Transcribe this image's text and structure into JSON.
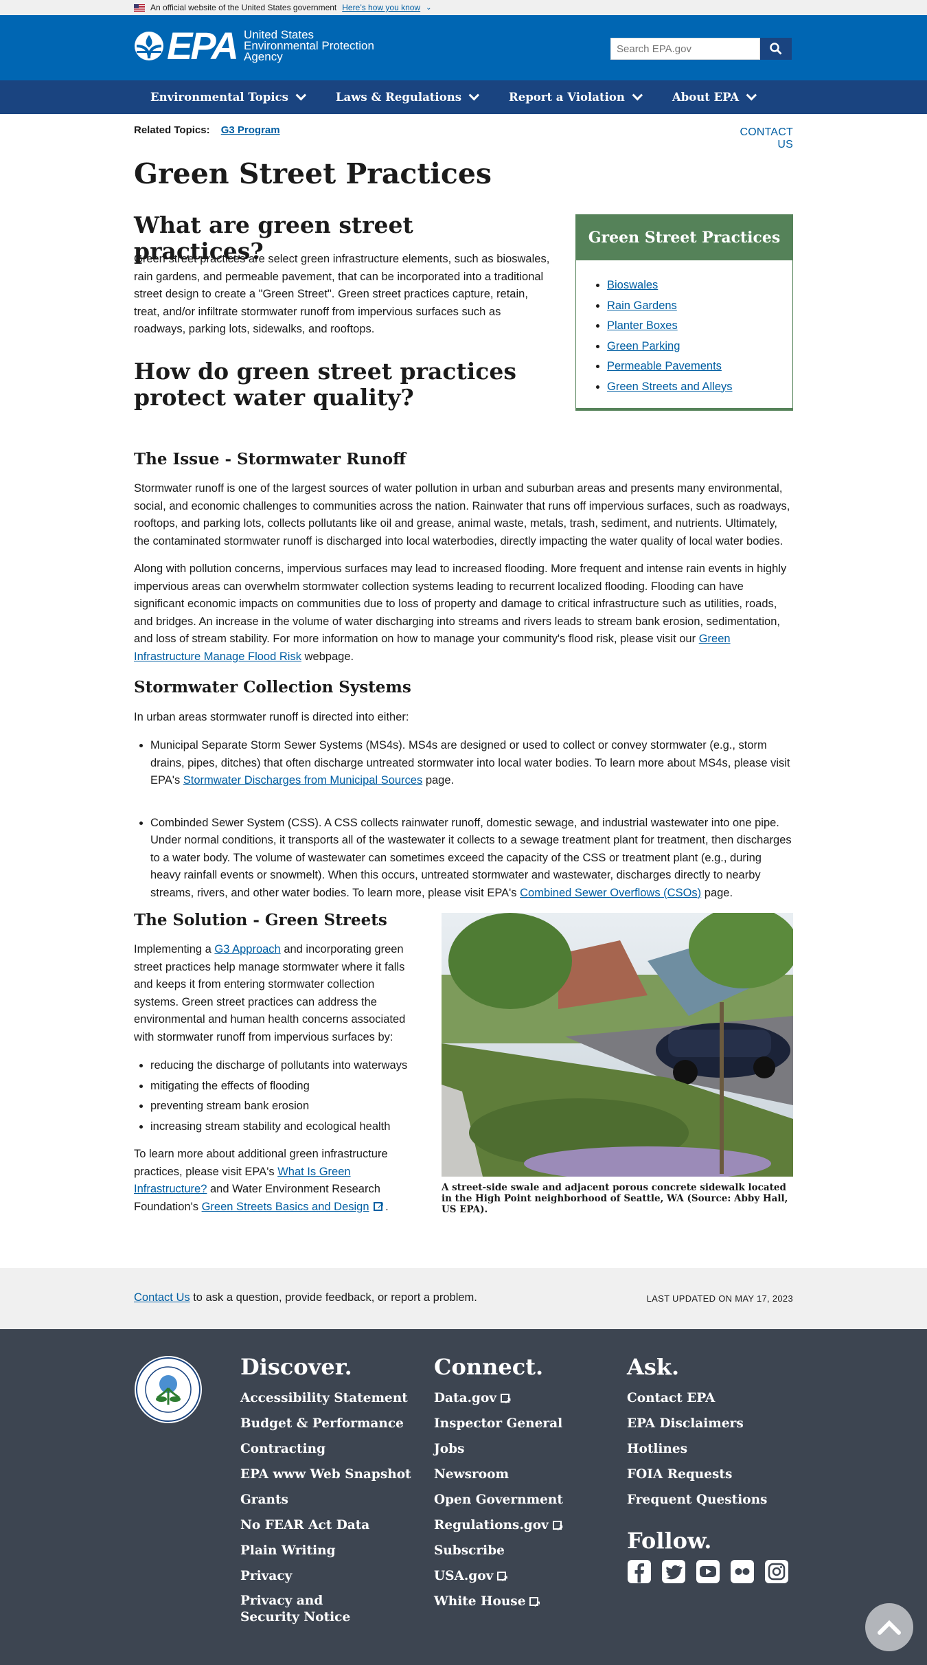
{
  "gov_banner": {
    "text": "An official website of the United States government",
    "link": "Here’s how you know"
  },
  "header": {
    "logo_text": "EPA",
    "agency_line1": "United States",
    "agency_line2": "Environmental Protection",
    "agency_line3": "Agency",
    "search_placeholder": "Search EPA.gov"
  },
  "nav": [
    "Environmental Topics",
    "Laws & Regulations",
    "Report a Violation",
    "About EPA"
  ],
  "related": {
    "label": "Related Topics:",
    "link": "G3 Program",
    "contact": "CONTACT US"
  },
  "page_title": "Green Street Practices",
  "what": {
    "heading": "What are green street practices?",
    "body": "Green street practices are select green infrastructure elements, such as bioswales, rain gardens, and permeable pavement, that can be incorporated into a traditional street design to create a \"Green Street\". Green street practices capture, retain, treat, and/or infiltrate stormwater runoff from impervious surfaces such as roadways, parking lots, sidewalks, and rooftops."
  },
  "how": {
    "heading": "How do green street practices protect water quality?"
  },
  "sidebar": {
    "title": "Green Street Practices",
    "links": [
      "Bioswales",
      "Rain Gardens",
      "Planter Boxes",
      "Green Parking",
      "Permeable Pavements",
      "Green Streets and Alleys"
    ]
  },
  "issue": {
    "heading": "The Issue - Stormwater Runoff",
    "p1": "Stormwater runoff is one of the largest sources of water pollution in urban and suburban areas and presents many environmental, social, and economic challenges to communities across the nation. Rainwater that runs off impervious surfaces, such as roadways, rooftops, and parking lots, collects pollutants like oil and grease, animal waste, metals, trash, sediment, and nutrients.  Ultimately, the contaminated stormwater runoff is discharged into local waterbodies, directly impacting the water quality of local water bodies.",
    "p2_before": "Along with pollution concerns, impervious surfaces may lead to increased flooding.  More frequent and intense rain events in highly impervious areas can overwhelm stormwater collection systems leading to recurrent localized flooding.  Flooding can have significant economic impacts on communities due to loss of property and damage to critical infrastructure such as utilities, roads, and bridges.  An increase in the volume of water discharging into streams and rivers leads to stream bank erosion, sedimentation, and loss of stream stability.  For more information on how to manage your community's flood risk, please visit our ",
    "p2_link": "Green Infrastructure Manage Flood Risk",
    "p2_after": " webpage."
  },
  "collection": {
    "heading": "Stormwater Collection Systems",
    "intro": "In urban areas stormwater runoff is directed into either:",
    "ms4_before": "Municipal Separate Storm Sewer Systems (MS4s).  MS4s are designed or used to collect or convey stormwater (e.g., storm drains, pipes, ditches) that often discharge untreated stormwater into local water bodies.  To learn more about MS4s, please visit EPA's ",
    "ms4_link": "Stormwater Discharges from Municipal Sources",
    "ms4_after": " page.",
    "css_before": "Combinded Sewer System (CSS).  A CSS collects rainwater runoff, domestic sewage, and industrial wastewater into one pipe.  Under normal conditions, it transports all of the wastewater it collects to a sewage treatment plant for treatment, then discharges to a water body. The volume of wastewater can sometimes exceed the capacity of the CSS or treatment plant (e.g., during heavy rainfall events or snowmelt). When this occurs, untreated stormwater and wastewater, discharges directly to nearby streams, rivers, and other water bodies.  To learn more, please visit EPA's ",
    "css_link": "Combined Sewer Overflows (CSOs)",
    "css_after": " page."
  },
  "solution": {
    "heading": "The Solution - Green Streets",
    "p1_before": "Implementing a ",
    "p1_link": "G3 Approach",
    "p1_after": " and incorporating green street practices help manage stormwater where it falls and keeps it from entering stormwater collection systems. Green street practices can address the environmental and human health concerns associated with stormwater runoff from impervious surfaces by:",
    "bullets": [
      "reducing the discharge of pollutants into waterways",
      "mitigating the effects of flooding",
      "preventing stream bank erosion",
      "increasing stream stability and ecological health"
    ],
    "p2_a": "To learn more about additional green infrastructure practices, please visit EPA's ",
    "p2_link1": "What Is Green Infrastructure?",
    "p2_b": " and Water Environment Research Foundation's ",
    "p2_link2": "Green Streets Basics and Design",
    "p2_c": " .",
    "caption": "A street-side swale and adjacent porous concrete sidewalk located in the High Point neighborhood of Seattle, WA (Source: Abby Hall, US EPA)."
  },
  "update": {
    "contact_link": "Contact Us",
    "contact_text": " to ask a question, provide feedback, or report a problem.",
    "updated": "LAST UPDATED ON MAY 17, 2023"
  },
  "footer": {
    "discover": {
      "title": "Discover.",
      "links": [
        "Accessibility Statement",
        "Budget & Performance",
        "Contracting",
        "EPA www Web Snapshot",
        "Grants",
        "No FEAR Act Data",
        "Plain Writing",
        "Privacy",
        "Privacy and Security Notice"
      ]
    },
    "connect": {
      "title": "Connect.",
      "links": [
        "Data.gov",
        "Inspector General",
        "Jobs",
        "Newsroom",
        "Open Government",
        "Regulations.gov",
        "Subscribe",
        "USA.gov",
        "White House"
      ],
      "external": [
        true,
        false,
        false,
        false,
        false,
        true,
        false,
        true,
        true
      ]
    },
    "ask": {
      "title": "Ask.",
      "links": [
        "Contact EPA",
        "EPA Disclaimers",
        "Hotlines",
        "FOIA Requests",
        "Frequent Questions"
      ]
    },
    "follow": {
      "title": "Follow.",
      "icons": [
        "facebook-icon",
        "twitter-icon",
        "youtube-icon",
        "flickr-icon",
        "instagram-icon"
      ]
    }
  },
  "colors": {
    "header_blue": "#0066b3",
    "nav_navy": "#1a4480",
    "sidebar_green": "#558259",
    "footer_gray": "#3d4551",
    "link": "#005ea2"
  }
}
